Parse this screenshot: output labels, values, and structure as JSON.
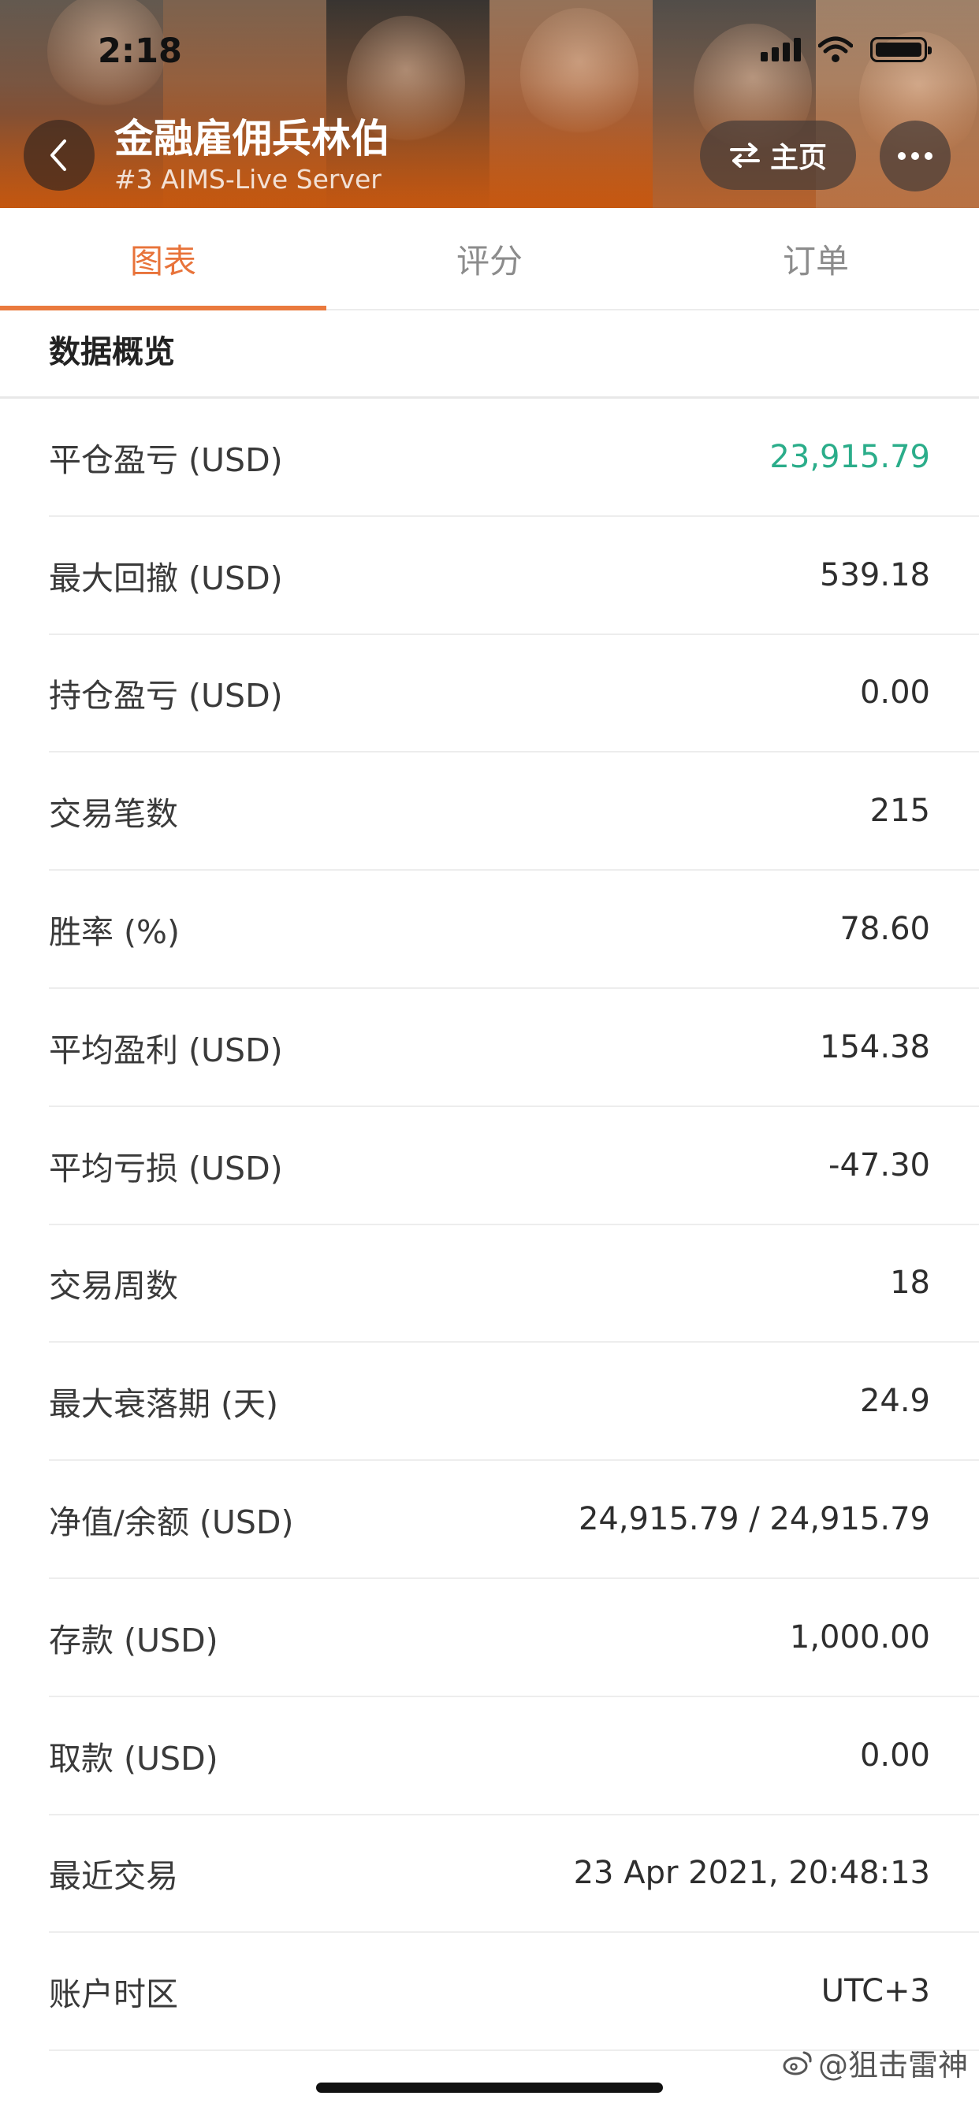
{
  "status_bar": {
    "time": "2:18"
  },
  "header": {
    "title": "金融雇佣兵林伯",
    "subtitle": "#3 AIMS-Live Server",
    "home_label": "主页"
  },
  "tabs": [
    {
      "label": "图表",
      "active": true
    },
    {
      "label": "评分",
      "active": false
    },
    {
      "label": "订单",
      "active": false
    }
  ],
  "section": {
    "title": "数据概览"
  },
  "stats": [
    {
      "label": "平仓盈亏 (USD)",
      "value": "23,915.79",
      "tone": "positive"
    },
    {
      "label": "最大回撤 (USD)",
      "value": "539.18"
    },
    {
      "label": "持仓盈亏 (USD)",
      "value": "0.00"
    },
    {
      "label": "交易笔数",
      "value": "215"
    },
    {
      "label": "胜率 (%)",
      "value": "78.60"
    },
    {
      "label": "平均盈利 (USD)",
      "value": "154.38"
    },
    {
      "label": "平均亏损 (USD)",
      "value": "-47.30"
    },
    {
      "label": "交易周数",
      "value": "18"
    },
    {
      "label": "最大衰落期 (天)",
      "value": "24.9"
    },
    {
      "label": "净值/余额 (USD)",
      "value": "24,915.79 / 24,915.79"
    },
    {
      "label": "存款 (USD)",
      "value": "1,000.00"
    },
    {
      "label": "取款 (USD)",
      "value": "0.00"
    },
    {
      "label": "最近交易",
      "value": "23 Apr 2021, 20:48:13"
    },
    {
      "label": "账户时区",
      "value": "UTC+3"
    }
  ],
  "watermark": "@狙击雷神",
  "colors": {
    "accent": "#ea7a3e",
    "positive": "#2bad8a"
  },
  "icons": {
    "back": "chevron-left-icon",
    "swap": "swap-arrows-icon",
    "more": "more-dots-icon",
    "signal": "cellular-signal-icon",
    "wifi": "wifi-icon",
    "battery": "battery-icon",
    "watermark": "weibo-icon"
  }
}
